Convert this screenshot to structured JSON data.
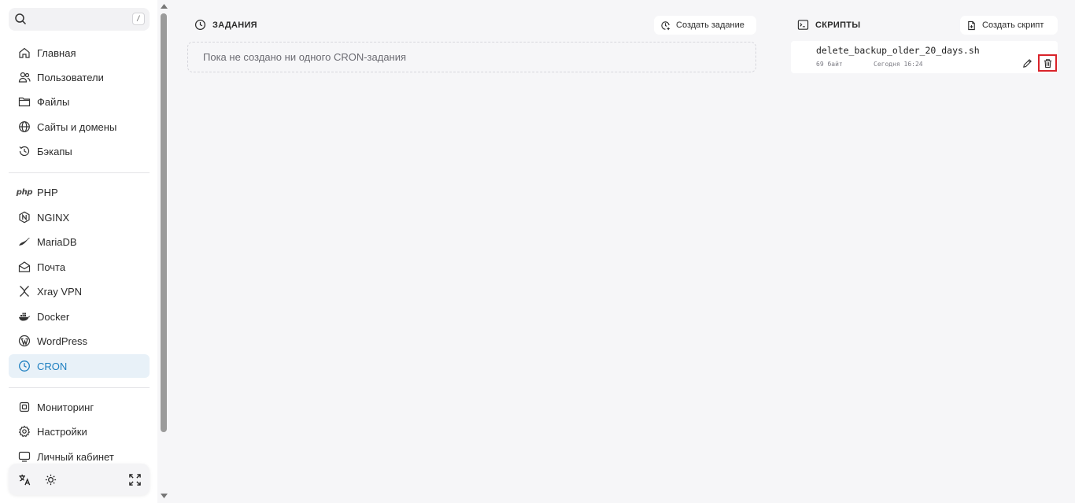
{
  "search": {
    "placeholder": "",
    "shortcut": "/"
  },
  "sidebar": {
    "group1": [
      {
        "label": "Главная",
        "icon": "home-icon"
      },
      {
        "label": "Пользователи",
        "icon": "users-icon"
      },
      {
        "label": "Файлы",
        "icon": "folder-icon"
      },
      {
        "label": "Сайты и домены",
        "icon": "globe-icon"
      },
      {
        "label": "Бэкапы",
        "icon": "history-icon"
      }
    ],
    "group2": [
      {
        "label": "PHP",
        "icon": "php-icon",
        "icon_text": "php"
      },
      {
        "label": "NGINX",
        "icon": "nginx-icon"
      },
      {
        "label": "MariaDB",
        "icon": "mariadb-icon"
      },
      {
        "label": "Почта",
        "icon": "mail-icon"
      },
      {
        "label": "Xray VPN",
        "icon": "xray-icon"
      },
      {
        "label": "Docker",
        "icon": "docker-icon"
      },
      {
        "label": "WordPress",
        "icon": "wordpress-icon"
      },
      {
        "label": "CRON",
        "icon": "clock-icon",
        "active": true
      }
    ],
    "group3": [
      {
        "label": "Мониторинг",
        "icon": "cpu-icon"
      },
      {
        "label": "Настройки",
        "icon": "gear-icon"
      },
      {
        "label": "Личный кабинет",
        "icon": "monitor-icon"
      }
    ],
    "accent_color": "#1d7fc0"
  },
  "bottom_bar": {
    "buttons": [
      "translate-icon",
      "sun-icon",
      "fullscreen-icon"
    ]
  },
  "tasks": {
    "title": "ЗАДАНИЯ",
    "create_label": "Создать задание",
    "empty_text": "Пока не создано ни одного CRON-задания"
  },
  "scripts": {
    "title": "СКРИПТЫ",
    "create_label": "Создать скрипт",
    "items": [
      {
        "name": "delete_backup_older_20_days.sh",
        "size": "69 байт",
        "modified": "Сегодня 16:24"
      }
    ]
  }
}
